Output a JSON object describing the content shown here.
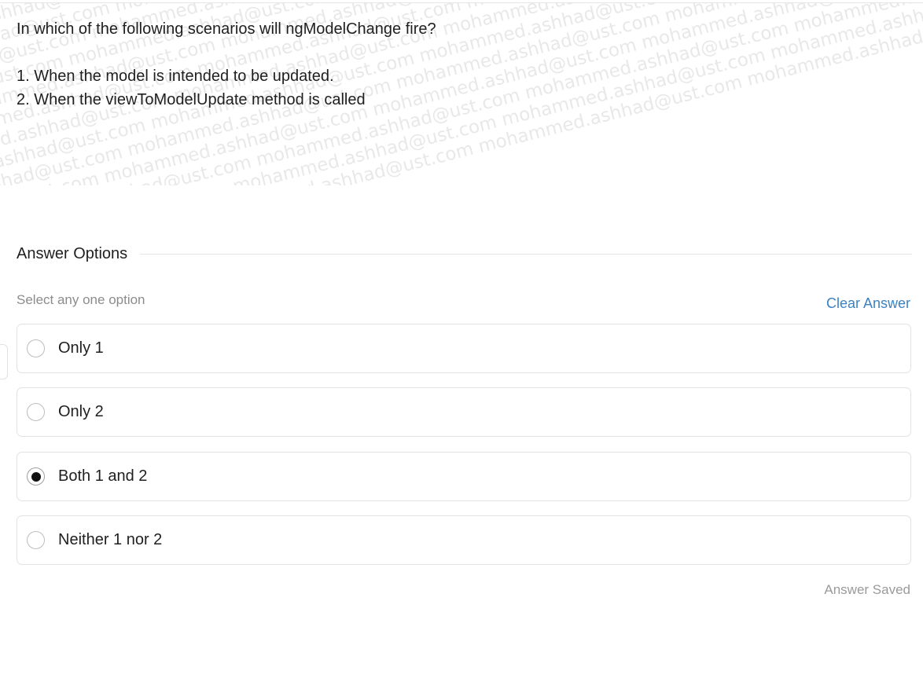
{
  "question": {
    "title": "In which of the following scenarios will ngModelChange fire?",
    "statements": [
      "1. When the model is intended to be updated.",
      "2. When the viewToModelUpdate method is called"
    ],
    "watermark": "mohammed.ashhad@ust.com"
  },
  "answers": {
    "section_title": "Answer Options",
    "hint": "Select any one option",
    "clear_label": "Clear Answer",
    "selected_index": 2,
    "options": [
      {
        "label": "Only 1"
      },
      {
        "label": "Only 2"
      },
      {
        "label": "Both 1 and 2"
      },
      {
        "label": "Neither 1 nor 2"
      }
    ],
    "status": "Answer Saved"
  }
}
